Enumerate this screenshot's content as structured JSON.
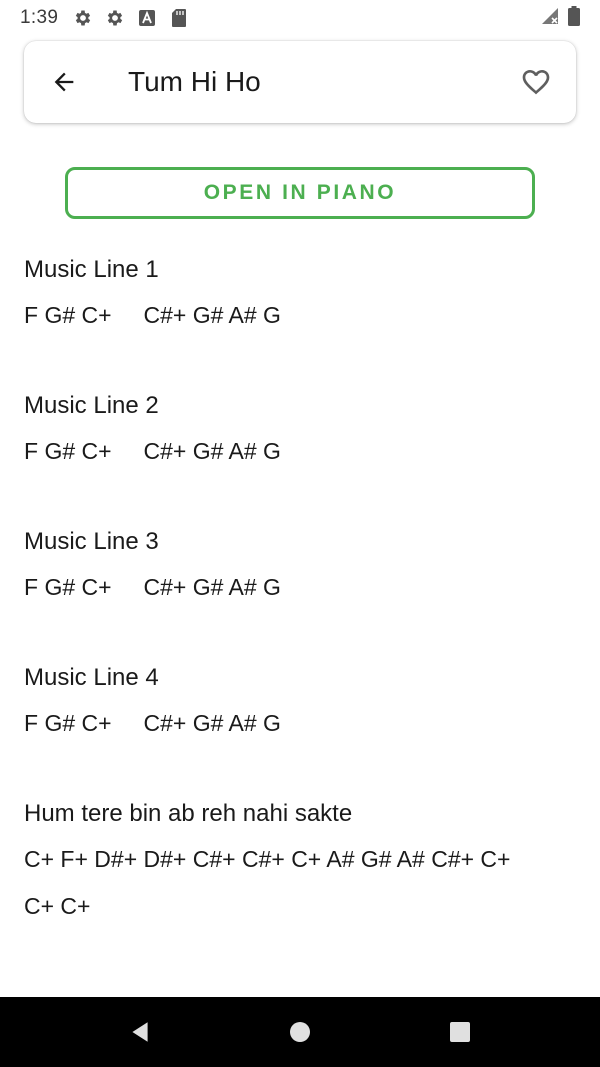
{
  "status_bar": {
    "time": "1:39",
    "icons": [
      "settings-icon",
      "settings-icon",
      "font-a-icon",
      "sd-card-icon"
    ],
    "right_icons": [
      "signal-icon",
      "battery-icon"
    ]
  },
  "toolbar": {
    "title": "Tum Hi Ho",
    "back_icon": "arrow-left-icon",
    "favorite_icon": "heart-outline-icon"
  },
  "open_button": {
    "label": "OPEN IN PIANO",
    "color": "#4caf50"
  },
  "sections": [
    {
      "title": "Music Line 1",
      "notes": "F G# C+     C#+ G# A# G"
    },
    {
      "title": "Music Line 2",
      "notes": "F G# C+     C#+ G# A# G"
    },
    {
      "title": "Music Line 3",
      "notes": "F G# C+     C#+ G# A# G"
    },
    {
      "title": "Music Line 4",
      "notes": "F G# C+     C#+ G# A# G"
    },
    {
      "title": "Hum tere bin ab reh nahi sakte",
      "notes": "C+ F+ D#+ D#+ C#+ C#+ C+ A# G# A# C#+ C+\nC+ C+"
    }
  ],
  "nav_bar": {
    "icons": [
      "back-triangle-icon",
      "home-circle-icon",
      "recents-square-icon"
    ]
  }
}
